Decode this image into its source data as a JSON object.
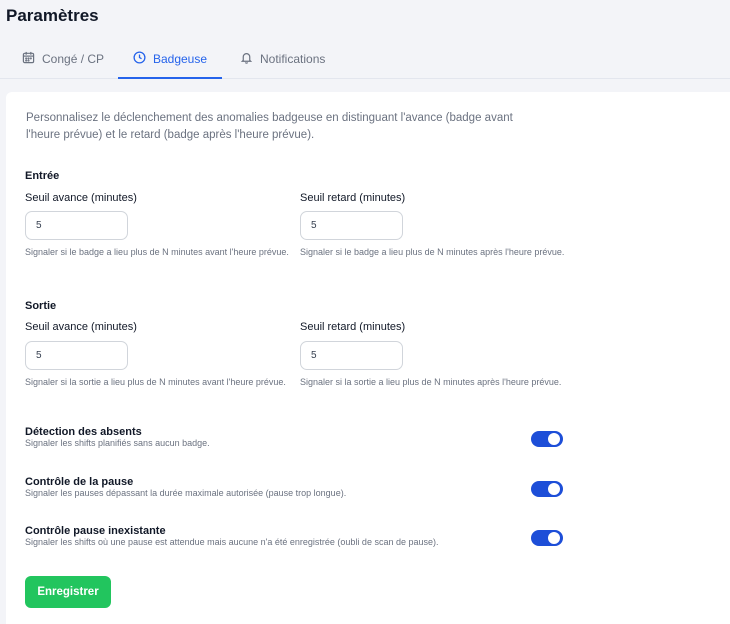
{
  "page": {
    "title": "Paramètres"
  },
  "tabs": [
    {
      "label": "Congé / CP",
      "icon": "calendar-icon",
      "active": false
    },
    {
      "label": "Badgeuse",
      "icon": "clock-icon",
      "active": true
    },
    {
      "label": "Notifications",
      "icon": "bell-icon",
      "active": false
    }
  ],
  "intro": "Personnalisez le déclenchement des anomalies badgeuse en distinguant l'avance (badge avant l'heure prévue) et le retard (badge après l'heure prévue).",
  "entree": {
    "title": "Entrée",
    "avance": {
      "label": "Seuil avance (minutes)",
      "value": "5",
      "help": "Signaler si le badge a lieu plus de N minutes avant l'heure prévue."
    },
    "retard": {
      "label": "Seuil retard (minutes)",
      "value": "5",
      "help": "Signaler si le badge a lieu plus de N minutes après l'heure prévue."
    }
  },
  "sortie": {
    "title": "Sortie",
    "avance": {
      "label": "Seuil avance (minutes)",
      "value": "5",
      "help": "Signaler si la sortie a lieu plus de N minutes avant l'heure prévue."
    },
    "retard": {
      "label": "Seuil retard (minutes)",
      "value": "5",
      "help": "Signaler si la sortie a lieu plus de N minutes après l'heure prévue."
    }
  },
  "toggles": [
    {
      "title": "Détection des absents",
      "description": "Signaler les shifts planifiés sans aucun badge.",
      "enabled": true
    },
    {
      "title": "Contrôle de la pause",
      "description": "Signaler les pauses dépassant la durée maximale autorisée (pause trop longue).",
      "enabled": true
    },
    {
      "title": "Contrôle pause inexistante",
      "description": "Signaler les shifts où une pause est attendue mais aucune n'a été enregistrée (oubli de scan de pause).",
      "enabled": true
    }
  ],
  "actions": {
    "save_label": "Enregistrer"
  },
  "colors": {
    "accent": "#2563eb",
    "toggle_on": "#1d4ed8",
    "save": "#22c55e"
  }
}
